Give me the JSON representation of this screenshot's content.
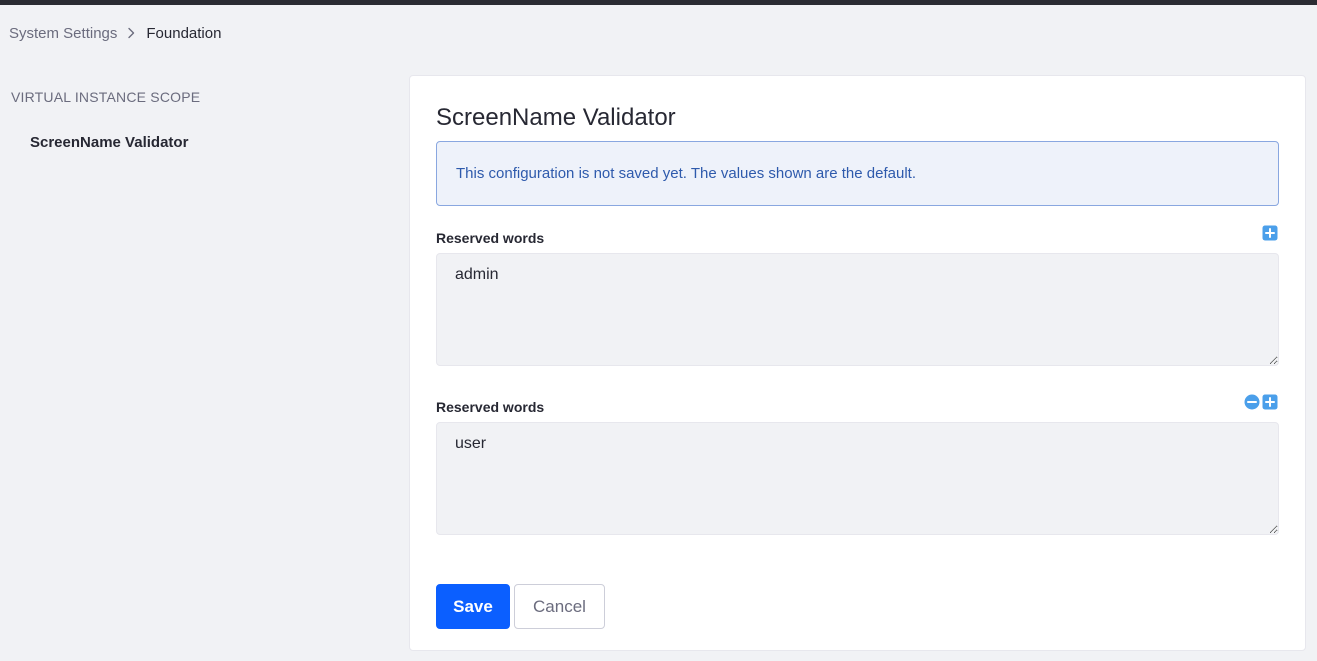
{
  "breadcrumb": {
    "parent": "System Settings",
    "current": "Foundation"
  },
  "sidebar": {
    "scope_title": "VIRTUAL INSTANCE SCOPE",
    "items": [
      {
        "label": "ScreenName Validator"
      }
    ]
  },
  "main": {
    "title": "ScreenName Validator",
    "alert": "This configuration is not saved yet. The values shown are the default.",
    "fields": [
      {
        "label": "Reserved words",
        "value": "admin"
      },
      {
        "label": "Reserved words",
        "value": "user"
      }
    ],
    "save_label": "Save",
    "cancel_label": "Cancel"
  },
  "colors": {
    "primary": "#0b5fff",
    "info_bg": "#eef2fa",
    "info_border": "#89a7e0",
    "info_text": "#2e5aac",
    "field_action_icon": "#4b9fea",
    "topbar": "#2b2c33"
  },
  "icons": {
    "breadcrumb_separator": "chevron-right-icon",
    "add_field": "plus-square-icon",
    "remove_field": "minus-circle-icon"
  }
}
